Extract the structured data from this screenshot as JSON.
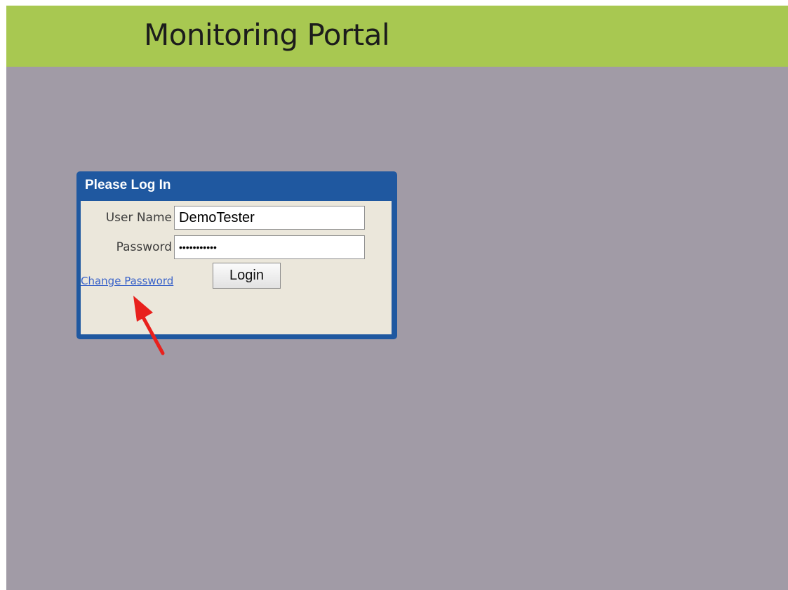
{
  "header": {
    "title": "Monitoring Portal"
  },
  "login": {
    "panel_title": "Please Log In",
    "username_label": "User Name",
    "username_value": "DemoTester",
    "password_label": "Password",
    "password_value": "DemoTester1",
    "login_button_label": "Login",
    "change_password_link": "Change Password"
  },
  "annotation": {
    "arrow_color": "#e8211d",
    "arrow_icon": "red-arrow-pointing-to-change-password"
  },
  "colors": {
    "header_bg": "#a8c851",
    "page_bg": "#a19ba6",
    "panel_border": "#1f58a0",
    "panel_bg": "#ebe7db",
    "link": "#3a63c9"
  }
}
